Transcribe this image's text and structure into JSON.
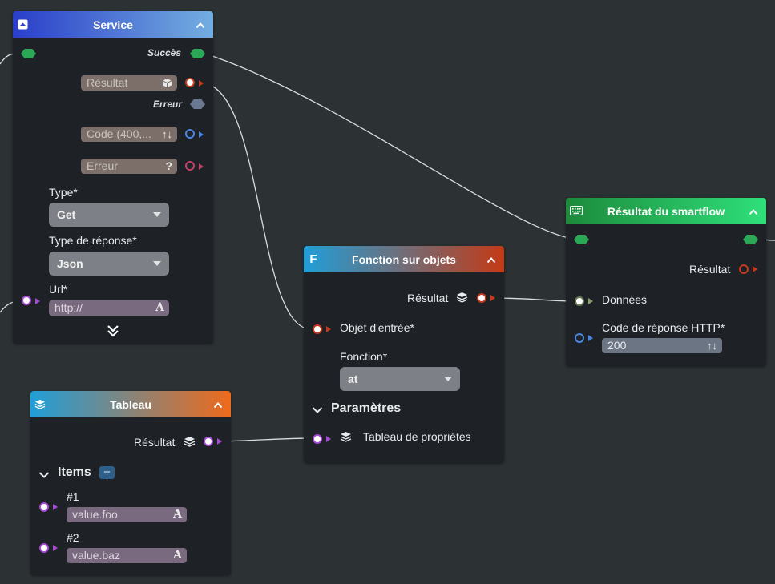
{
  "colors": {
    "canvas": "#2c3234",
    "node_body": "#1e2227",
    "flow_port": "#2aa855",
    "wire": "#d9dcdf"
  },
  "nodes": {
    "service": {
      "title": "Service",
      "icon": "box-icon",
      "success_label": "Succès",
      "result_placeholder": "Résultat",
      "error_label": "Erreur",
      "code_placeholder": "Code (400,...",
      "error_placeholder": "Erreur",
      "type_label": "Type*",
      "type_value": "Get",
      "response_type_label": "Type de réponse*",
      "response_type_value": "Json",
      "url_label": "Url*",
      "url_placeholder": "http://",
      "header_gradient": [
        "#2a3ec9",
        "#74aee0"
      ]
    },
    "fonction": {
      "title": "Fonction sur objets",
      "icon_glyph": "F",
      "result_label": "Résultat",
      "input_object_label": "Objet d'entrée*",
      "function_label": "Fonction*",
      "function_value": "at",
      "params_section": "Paramètres",
      "props_table_label": "Tableau de propriétés",
      "header_gradient": [
        "#1f9fd8",
        "#c43a16"
      ]
    },
    "tableau": {
      "title": "Tableau",
      "result_label": "Résultat",
      "items_section": "Items",
      "add_label": "+",
      "items": [
        {
          "label": "#1",
          "value": "value.foo"
        },
        {
          "label": "#2",
          "value": "value.baz"
        }
      ],
      "header_gradient": [
        "#1f9fd8",
        "#ef6a1c"
      ]
    },
    "smartflow": {
      "title": "Résultat du smartflow",
      "icon": "keyboard-icon",
      "result_label": "Résultat",
      "data_label": "Données",
      "http_code_label": "Code de réponse HTTP*",
      "http_code_value": "200",
      "header_gradient": [
        "#1c8a3a",
        "#2fe07a"
      ]
    }
  }
}
